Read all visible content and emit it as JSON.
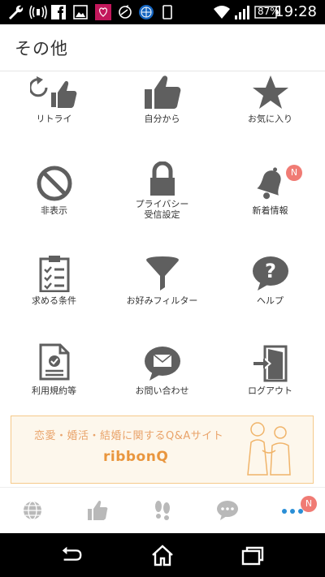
{
  "status_bar": {
    "battery": "87%",
    "time": "19:28"
  },
  "header": {
    "title": "その他"
  },
  "menu": [
    {
      "label": "リトライ",
      "icon": "retry-thumb-icon"
    },
    {
      "label": "自分から",
      "icon": "thumbs-up-icon"
    },
    {
      "label": "お気に入り",
      "icon": "star-icon"
    },
    {
      "label": "非表示",
      "icon": "prohibited-icon"
    },
    {
      "label": "プライバシー\n受信設定",
      "icon": "lock-icon"
    },
    {
      "label": "新着情報",
      "icon": "bell-icon",
      "badge": "N"
    },
    {
      "label": "求める条件",
      "icon": "clipboard-checklist-icon"
    },
    {
      "label": "お好みフィルター",
      "icon": "funnel-icon"
    },
    {
      "label": "ヘルプ",
      "icon": "help-bubble-icon"
    },
    {
      "label": "利用規約等",
      "icon": "document-check-icon"
    },
    {
      "label": "お問い合わせ",
      "icon": "mail-bubble-icon"
    },
    {
      "label": "ログアウト",
      "icon": "logout-door-icon"
    }
  ],
  "banner": {
    "headline": "恋愛・婚活・結婚に関するQ&Aサイト",
    "brand": "ribbonQ"
  },
  "tabbar": {
    "tabs": [
      {
        "icon": "globe-icon"
      },
      {
        "icon": "thumbs-up-icon"
      },
      {
        "icon": "footprints-icon"
      },
      {
        "icon": "chat-bubble-icon"
      },
      {
        "icon": "more-dots-icon",
        "badge": "N"
      }
    ]
  },
  "colors": {
    "icon_gray": "#5f5f5f",
    "tab_gray": "#b9b9b9",
    "accent_blue": "#2a8fd6",
    "badge_red": "#f07b74",
    "banner_orange": "#e9963e"
  }
}
